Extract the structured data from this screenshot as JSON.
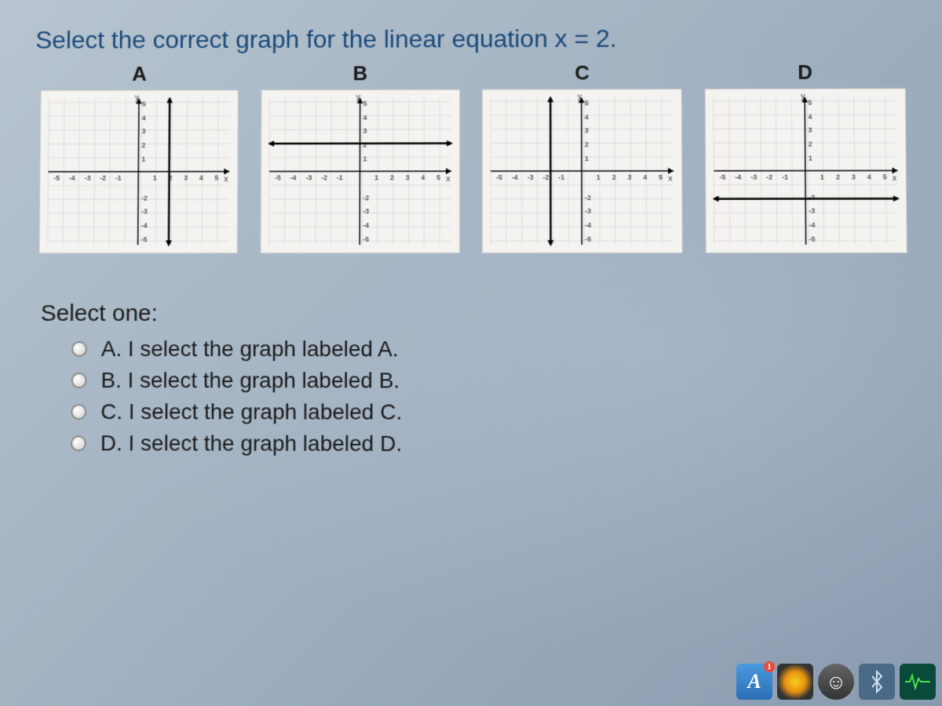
{
  "question": "Select the correct graph for the linear equation x = 2.",
  "graphs": {
    "labels": [
      "A",
      "B",
      "C",
      "D"
    ],
    "axis_y": "y",
    "axis_x": "x",
    "x_ticks_neg": [
      "-5",
      "-4",
      "-3",
      "-2",
      "-1"
    ],
    "x_ticks_pos": [
      "1",
      "2",
      "3",
      "4",
      "5"
    ],
    "y_ticks_pos": [
      "5",
      "4",
      "3",
      "2",
      "1"
    ],
    "y_ticks_neg": [
      "-2",
      "-3",
      "-4",
      "-5"
    ]
  },
  "prompt": "Select one:",
  "options": {
    "a": "A. I select the graph labeled A.",
    "b": "B. I select the graph labeled B.",
    "c": "C. I select the graph labeled C.",
    "d": "D. I select the graph labeled D."
  },
  "chart_data": [
    {
      "type": "line",
      "label": "A",
      "xlim": [
        -5,
        5
      ],
      "ylim": [
        -5,
        5
      ],
      "xlabel": "x",
      "ylabel": "y",
      "description": "vertical line at x = 2",
      "line": {
        "orientation": "vertical",
        "x": 2,
        "y_range": [
          -5,
          5
        ]
      }
    },
    {
      "type": "line",
      "label": "B",
      "xlim": [
        -5,
        5
      ],
      "ylim": [
        -5,
        5
      ],
      "xlabel": "x",
      "ylabel": "y",
      "description": "horizontal line at y = 2",
      "line": {
        "orientation": "horizontal",
        "y": 2,
        "x_range": [
          -5,
          5
        ]
      }
    },
    {
      "type": "line",
      "label": "C",
      "xlim": [
        -5,
        5
      ],
      "ylim": [
        -5,
        5
      ],
      "xlabel": "x",
      "ylabel": "y",
      "description": "vertical line at x = -2",
      "line": {
        "orientation": "vertical",
        "x": -2,
        "y_range": [
          -5,
          5
        ]
      }
    },
    {
      "type": "line",
      "label": "D",
      "xlim": [
        -5,
        5
      ],
      "ylim": [
        -5,
        5
      ],
      "xlabel": "x",
      "ylabel": "y",
      "description": "horizontal line at y = -2",
      "line": {
        "orientation": "horizontal",
        "y": -2,
        "x_range": [
          -5,
          5
        ]
      }
    }
  ],
  "taskbar": {
    "badge_count": "1"
  }
}
